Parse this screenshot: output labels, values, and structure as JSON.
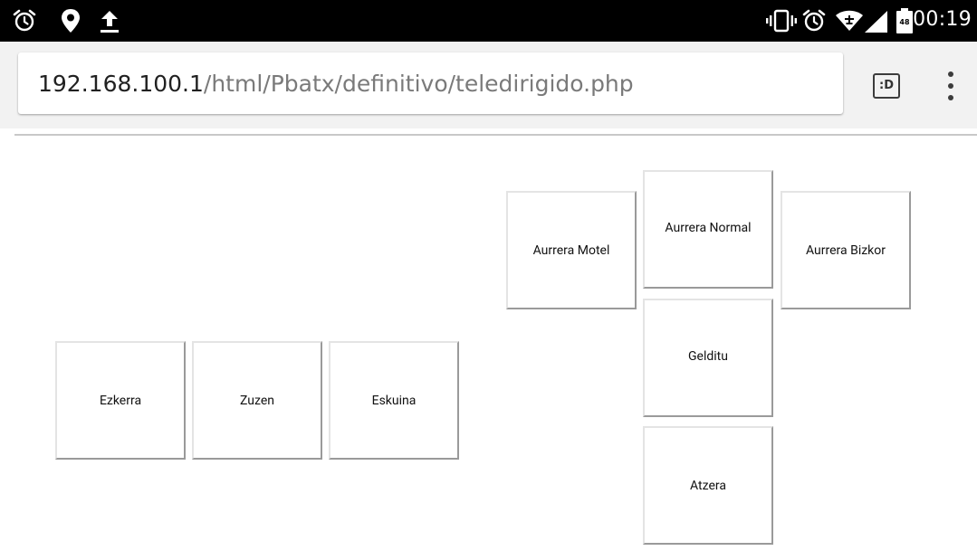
{
  "status_bar": {
    "time": "00:19",
    "battery_level": "48",
    "icons": [
      "alarm-icon",
      "location-icon",
      "upload-icon",
      "vibrate-icon",
      "alarm-icon",
      "wifi-icon",
      "signal-icon",
      "battery-icon"
    ]
  },
  "browser": {
    "url_host": "192.168.100.1",
    "url_path": "/html/Pbatx/definitivo/teledirigido.php",
    "reader_label": ":D"
  },
  "controls": {
    "left": "Ezkerra",
    "center": "Zuzen",
    "right": "Eskuina",
    "forward_slow": "Aurrera Motel",
    "forward_normal": "Aurrera Normal",
    "forward_fast": "Aurrera Bizkor",
    "stop": "Gelditu",
    "backward": "Atzera"
  },
  "colors": {
    "status_bar_bg": "#000000",
    "toolbar_bg": "#f2f2f2",
    "url_host": "#212121",
    "url_path": "#7a7a7a"
  }
}
